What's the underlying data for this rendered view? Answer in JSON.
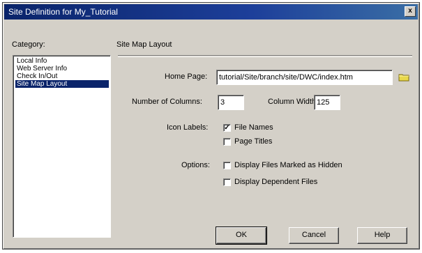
{
  "window": {
    "title": "Site Definition for My_Tutorial",
    "close_glyph": "x"
  },
  "category": {
    "heading": "Category:",
    "items": [
      "Local Info",
      "Web Server Info",
      "Check In/Out",
      "Site Map Layout"
    ],
    "selected_index": 3
  },
  "panel": {
    "heading": "Site Map Layout"
  },
  "form": {
    "home_page_label": "Home Page:",
    "home_page_value": "tutorial/Site/branch/site/DWC/index.htm",
    "columns_label": "Number of Columns:",
    "columns_value": "3",
    "column_width_label": "Column Width:",
    "column_width_value": "125",
    "icon_labels_label": "Icon Labels:",
    "file_names_label": "File Names",
    "page_titles_label": "Page Titles",
    "icon_labels_selected": "File Names",
    "options_label": "Options:",
    "hidden_files_label": "Display Files Marked as Hidden",
    "dependent_files_label": "Display Dependent Files",
    "hidden_files_checked": false,
    "dependent_files_checked": false
  },
  "buttons": {
    "ok": "OK",
    "cancel": "Cancel",
    "help": "Help"
  },
  "icons": {
    "folder": "folder-icon",
    "close": "close-icon"
  },
  "colors": {
    "titlebar": "#0a246a",
    "selection": "#0a246a",
    "dialog_bg": "#d4d0c8"
  }
}
